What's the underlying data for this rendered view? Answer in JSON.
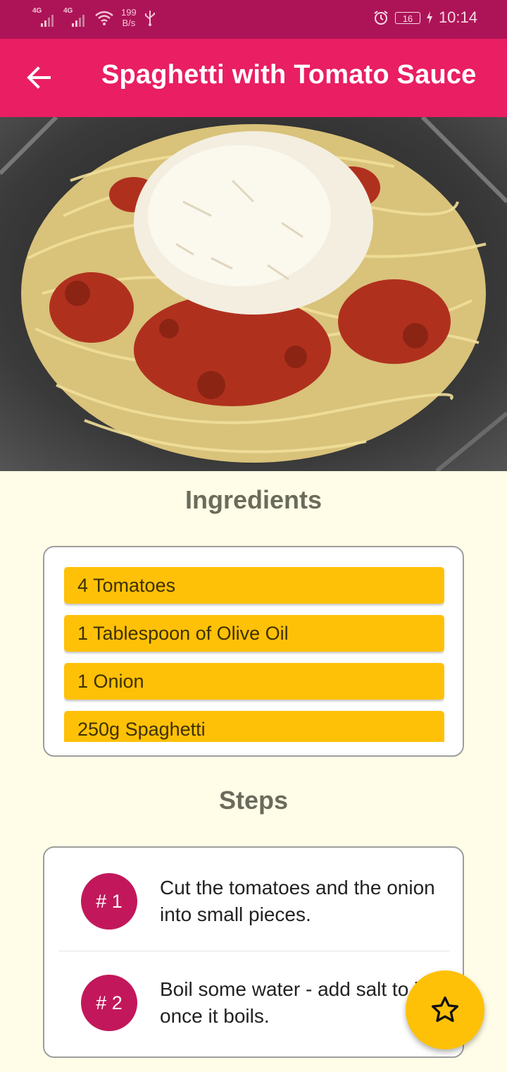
{
  "status_bar": {
    "network_1": "4G",
    "network_2": "4G",
    "speed_value": "199",
    "speed_unit": "B/s",
    "battery": "16",
    "time": "10:14",
    "icons": [
      "signal-icon",
      "signal-icon",
      "wifi-icon",
      "usb-icon",
      "alarm-icon",
      "battery-icon",
      "charging-icon"
    ]
  },
  "app_bar": {
    "title": "Spaghetti with Tomato Sauce",
    "back_icon": "arrow-left-icon"
  },
  "ingredients": {
    "heading": "Ingredients",
    "items": [
      "4 Tomatoes",
      "1 Tablespoon of Olive Oil",
      "1 Onion",
      "250g Spaghetti"
    ]
  },
  "steps": {
    "heading": "Steps",
    "items": [
      {
        "number": "# 1",
        "text": "Cut the tomatoes and the onion into small pieces."
      },
      {
        "number": "# 2",
        "text": "Boil some water - add salt to it once it boils."
      }
    ]
  },
  "fab": {
    "icon": "star-outline-icon"
  },
  "colors": {
    "status_bar": "#ad1457",
    "app_bar": "#e91e63",
    "background": "#fffde7",
    "ingredient_chip": "#ffc107",
    "step_badge": "#c2185b",
    "fab": "#ffc107"
  }
}
